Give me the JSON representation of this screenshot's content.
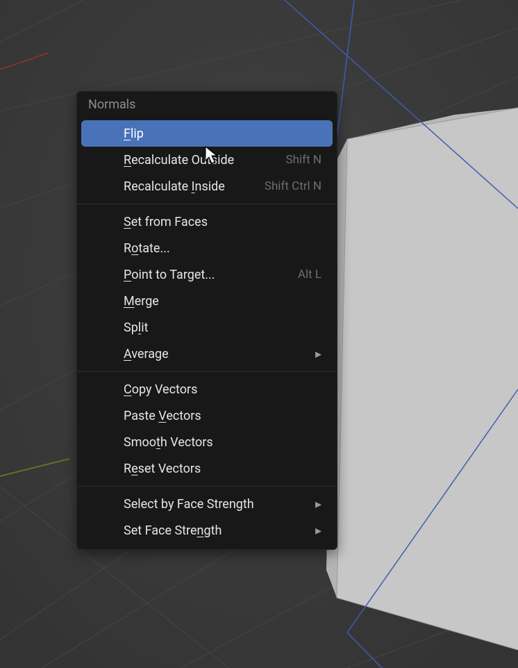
{
  "menu": {
    "title": "Normals",
    "groups": [
      [
        {
          "label": "Flip",
          "u": 0,
          "shortcut": "",
          "highlight": true,
          "name": "flip"
        },
        {
          "label": "Recalculate Outside",
          "u": 0,
          "shortcut": "Shift N",
          "name": "recalc-outside"
        },
        {
          "label": "Recalculate Inside",
          "u": 12,
          "shortcut": "Shift Ctrl N",
          "name": "recalc-inside"
        }
      ],
      [
        {
          "label": "Set from Faces",
          "u": 0,
          "name": "set-from-faces"
        },
        {
          "label": "Rotate...",
          "u": 1,
          "name": "rotate"
        },
        {
          "label": "Point to Target...",
          "u": 0,
          "shortcut": "Alt L",
          "name": "point-to-target"
        },
        {
          "label": "Merge",
          "u": 0,
          "name": "merge"
        },
        {
          "label": "Split",
          "u": 2,
          "name": "split"
        },
        {
          "label": "Average",
          "u": 0,
          "submenu": true,
          "name": "average"
        }
      ],
      [
        {
          "label": "Copy Vectors",
          "u": 0,
          "name": "copy-vectors"
        },
        {
          "label": "Paste Vectors",
          "u": 6,
          "name": "paste-vectors"
        },
        {
          "label": "Smooth Vectors",
          "u": 4,
          "name": "smooth-vectors"
        },
        {
          "label": "Reset Vectors",
          "u": 1,
          "name": "reset-vectors"
        }
      ],
      [
        {
          "label": "Select by Face Strength",
          "u": -1,
          "submenu": true,
          "name": "select-by-face-strength"
        },
        {
          "label": "Set Face Strength",
          "u": 13,
          "submenu": true,
          "name": "set-face-strength"
        }
      ]
    ]
  }
}
